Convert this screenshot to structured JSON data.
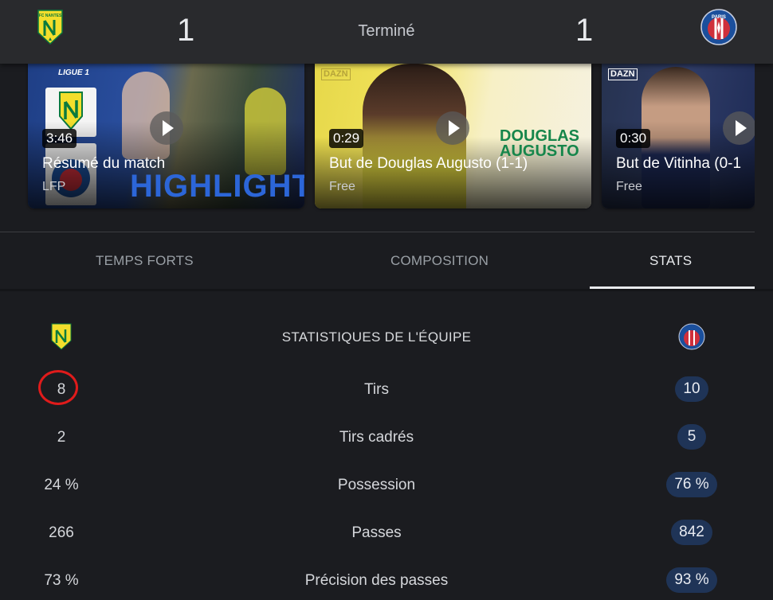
{
  "header": {
    "home_score": "1",
    "away_score": "1",
    "status": "Terminé",
    "home_logo": "fc-nantes-crest-icon",
    "away_logo": "paris-saint-germain-crest-icon",
    "home_logo_text": "FC NANTES",
    "away_logo_text": "PARIS"
  },
  "videos": [
    {
      "duration": "3:46",
      "title": "Résumé du match",
      "source": "LFP",
      "overlay_text": "HIGHLIGHTS",
      "badge": "LIGUE 1"
    },
    {
      "duration": "0:29",
      "title": "But de Douglas Augusto (1-1)",
      "source": "Free",
      "overlay_text_1": "DOUGLAS",
      "overlay_text_2": "AUGUSTO",
      "badge": "DAZN"
    },
    {
      "duration": "0:30",
      "title": "But de Vitinha (0-1",
      "source": "Free",
      "badge": "DAZN"
    }
  ],
  "tabs": [
    {
      "label": "TEMPS FORTS"
    },
    {
      "label": "COMPOSITION"
    },
    {
      "label": "STATS",
      "active": true
    }
  ],
  "stats": {
    "title": "STATISTIQUES DE L'ÉQUIPE",
    "rows": [
      {
        "label": "Tirs",
        "home": "8",
        "away": "10"
      },
      {
        "label": "Tirs cadrés",
        "home": "2",
        "away": "5"
      },
      {
        "label": "Possession",
        "home": "24 %",
        "away": "76 %"
      },
      {
        "label": "Passes",
        "home": "266",
        "away": "842"
      },
      {
        "label": "Précision des passes",
        "home": "73 %",
        "away": "93 %"
      }
    ]
  },
  "colors": {
    "background": "#1b1c20",
    "header": "#292a2d",
    "away_pill": "#1f3457",
    "highlight_ring": "#e01b1b",
    "nantes_yellow": "#f3de2c",
    "psg_blue": "#1b4f9c"
  }
}
